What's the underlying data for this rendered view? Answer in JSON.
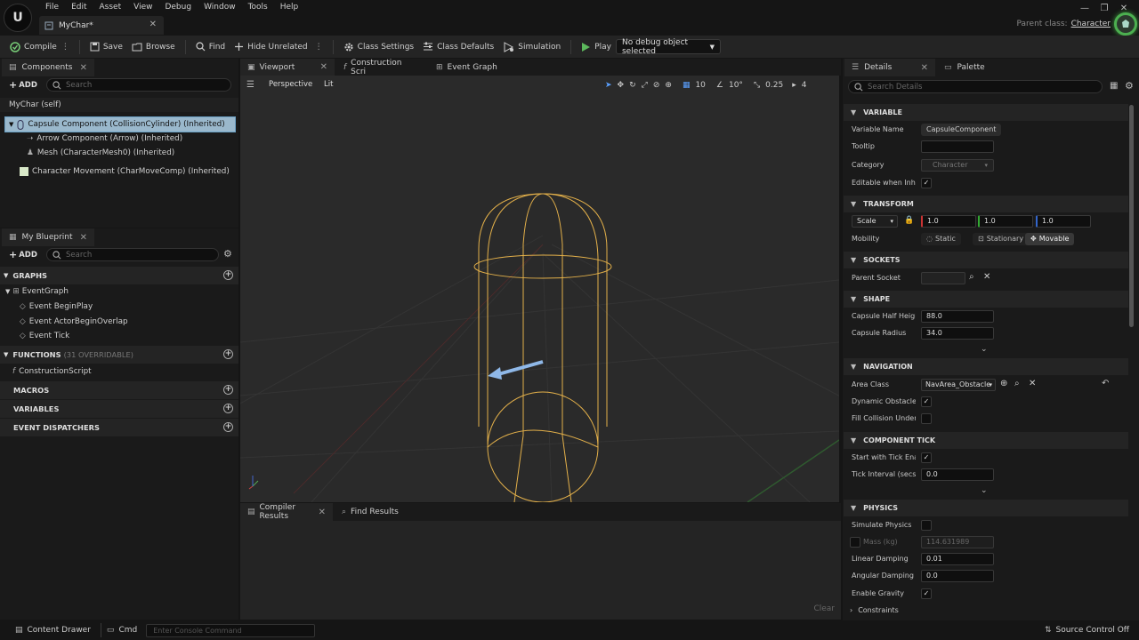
{
  "menu": [
    "File",
    "Edit",
    "Asset",
    "View",
    "Debug",
    "Window",
    "Tools",
    "Help"
  ],
  "doc_tab": {
    "title": "MyChar*"
  },
  "parent_class": {
    "label": "Parent class:",
    "value": "Character"
  },
  "toolbar": {
    "compile": "Compile",
    "save": "Save",
    "browse": "Browse",
    "find": "Find",
    "hide_unrelated": "Hide Unrelated",
    "class_settings": "Class Settings",
    "class_defaults": "Class Defaults",
    "simulation": "Simulation",
    "play": "Play",
    "debug_object": "No debug object selected"
  },
  "components": {
    "tab": "Components",
    "add": "ADD",
    "search_placeholder": "Search",
    "self": "MyChar (self)",
    "items": [
      "Capsule Component (CollisionCylinder) (Inherited)",
      "Arrow Component (Arrow) (Inherited)",
      "Mesh (CharacterMesh0) (Inherited)",
      "Character Movement (CharMoveComp) (Inherited)"
    ]
  },
  "my_blueprint": {
    "tab": "My Blueprint",
    "add": "ADD",
    "search_placeholder": "Search",
    "graphs": "GRAPHS",
    "event_graph": "EventGraph",
    "events": [
      "Event BeginPlay",
      "Event ActorBeginOverlap",
      "Event Tick"
    ],
    "functions": "FUNCTIONS",
    "functions_sub": "(31 OVERRIDABLE)",
    "construction_script": "ConstructionScript",
    "macros": "MACROS",
    "variables": "VARIABLES",
    "event_dispatchers": "EVENT DISPATCHERS"
  },
  "editor_tabs": {
    "viewport": "Viewport",
    "construction": "Construction Scri",
    "event_graph": "Event Graph"
  },
  "viewport": {
    "perspective": "Perspective",
    "lit": "Lit",
    "grid": "10",
    "angle": "10°",
    "scale": "0.25",
    "cam_speed": "4"
  },
  "bottom_tabs": {
    "compiler": "Compiler Results",
    "find": "Find Results",
    "clear": "Clear"
  },
  "details": {
    "tab": "Details",
    "palette": "Palette",
    "search_placeholder": "Search Details",
    "variable_hdr": "VARIABLE",
    "variable_name_label": "Variable Name",
    "variable_name": "CapsuleComponent",
    "tooltip_label": "Tooltip",
    "category_label": "Category",
    "category": "Character",
    "editable_label": "Editable when Inherit",
    "transform_hdr": "TRANSFORM",
    "scale_label": "Scale",
    "scale": [
      "1.0",
      "1.0",
      "1.0"
    ],
    "mobility_label": "Mobility",
    "mobility": [
      "Static",
      "Stationary",
      "Movable"
    ],
    "sockets_hdr": "SOCKETS",
    "parent_socket_label": "Parent Socket",
    "shape_hdr": "SHAPE",
    "half_height_label": "Capsule Half Height",
    "half_height": "88.0",
    "radius_label": "Capsule Radius",
    "radius": "34.0",
    "navigation_hdr": "NAVIGATION",
    "area_class_label": "Area Class",
    "area_class": "NavArea_Obstacle",
    "dynamic_obstacle_label": "Dynamic Obstacle",
    "fill_collision_label": "Fill Collision Underne",
    "component_tick_hdr": "COMPONENT TICK",
    "start_tick_label": "Start with Tick Enabl",
    "tick_interval_label": "Tick Interval (secs)",
    "tick_interval": "0.0",
    "physics_hdr": "PHYSICS",
    "simulate_label": "Simulate Physics",
    "mass_label": "Mass (kg)",
    "mass": "114.631989",
    "linear_damping_label": "Linear Damping",
    "linear_damping": "0.01",
    "angular_damping_label": "Angular Damping",
    "angular_damping": "0.0",
    "gravity_label": "Enable Gravity",
    "constraints_label": "Constraints"
  },
  "status": {
    "content_drawer": "Content Drawer",
    "cmd": "Cmd",
    "console_placeholder": "Enter Console Command",
    "source_control": "Source Control Off"
  },
  "colors": {
    "capsule": "#e3b04a",
    "arrow": "#8fb8e8",
    "selection": "#3f6e8e",
    "play": "#5cb85c"
  }
}
